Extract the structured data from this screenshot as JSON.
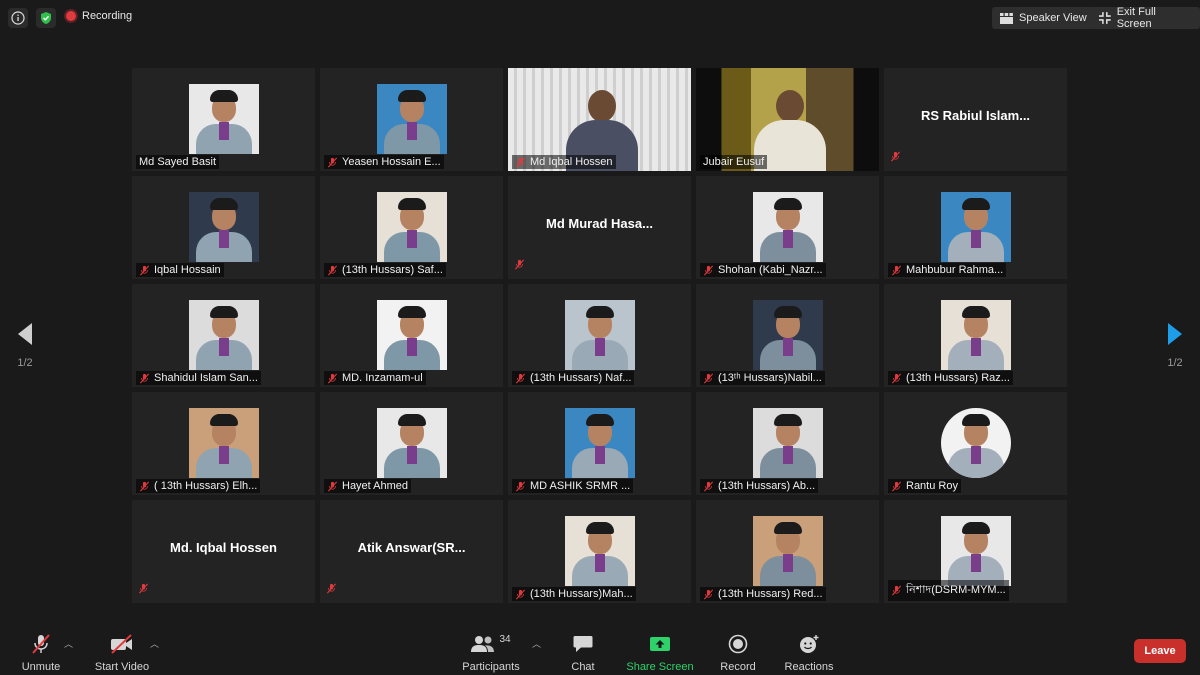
{
  "top": {
    "recording_label": "Recording",
    "speaker_view_label": "Speaker View",
    "exit_fullscreen_label": "Exit Full Screen"
  },
  "pager": {
    "left_label": "1/2",
    "right_label": "1/2"
  },
  "tiles": [
    {
      "name": "Md Sayed Basit",
      "muted": false,
      "kind": "photo"
    },
    {
      "name": "Yeasen Hossain E...",
      "muted": true,
      "kind": "photo"
    },
    {
      "name": "Md  Iqbal Hossen",
      "muted": true,
      "kind": "video"
    },
    {
      "name": "Jubair Eusuf",
      "muted": false,
      "kind": "video",
      "active": true
    },
    {
      "name": "RS Rabiul Islam...",
      "muted": true,
      "kind": "text"
    },
    {
      "name": "Iqbal Hossain",
      "muted": true,
      "kind": "photo"
    },
    {
      "name": "(13th Hussars) Saf...",
      "muted": true,
      "kind": "photo"
    },
    {
      "name": "Md  Murad Hasa...",
      "muted": true,
      "kind": "text"
    },
    {
      "name": "Shohan (Kabi_Nazr...",
      "muted": true,
      "kind": "photo"
    },
    {
      "name": "Mahbubur Rahma...",
      "muted": true,
      "kind": "photo"
    },
    {
      "name": "Shahidul Islam San...",
      "muted": true,
      "kind": "photo"
    },
    {
      "name": "MD. Inzamam-ul",
      "muted": true,
      "kind": "photo"
    },
    {
      "name": "(13th Hussars) Naf...",
      "muted": true,
      "kind": "photo"
    },
    {
      "name": "(13ᵗʰ Hussars)Nabil...",
      "muted": true,
      "kind": "photo"
    },
    {
      "name": "(13th Hussars) Raz...",
      "muted": true,
      "kind": "photo"
    },
    {
      "name": "( 13th Hussars) Elh...",
      "muted": true,
      "kind": "photo"
    },
    {
      "name": "Hayet Ahmed",
      "muted": true,
      "kind": "photo"
    },
    {
      "name": "MD ASHIK SRMR ...",
      "muted": true,
      "kind": "photo"
    },
    {
      "name": "(13th Hussars) Ab...",
      "muted": true,
      "kind": "photo"
    },
    {
      "name": "Rantu Roy",
      "muted": true,
      "kind": "photo",
      "round": true
    },
    {
      "name": "Md. Iqbal Hossen",
      "muted": true,
      "kind": "text"
    },
    {
      "name": "Atik Answar(SR...",
      "muted": true,
      "kind": "text"
    },
    {
      "name": "(13th Hussars)Mah...",
      "muted": true,
      "kind": "photo"
    },
    {
      "name": "(13th Hussars) Red...",
      "muted": true,
      "kind": "photo"
    },
    {
      "name": "নিশাদ(DSRM-MYM...",
      "muted": true,
      "kind": "photo"
    }
  ],
  "toolbar": {
    "unmute_label": "Unmute",
    "start_video_label": "Start Video",
    "participants_label": "Participants",
    "participants_count": "34",
    "chat_label": "Chat",
    "share_screen_label": "Share Screen",
    "record_label": "Record",
    "reactions_label": "Reactions",
    "leave_label": "Leave"
  },
  "colors": {
    "background": "#1a1a1a",
    "tile": "#232323",
    "active_speaker": "#d5e06a",
    "share_green": "#2fd26a",
    "leave_red": "#c9302c",
    "mute_red": "#e0393e"
  }
}
